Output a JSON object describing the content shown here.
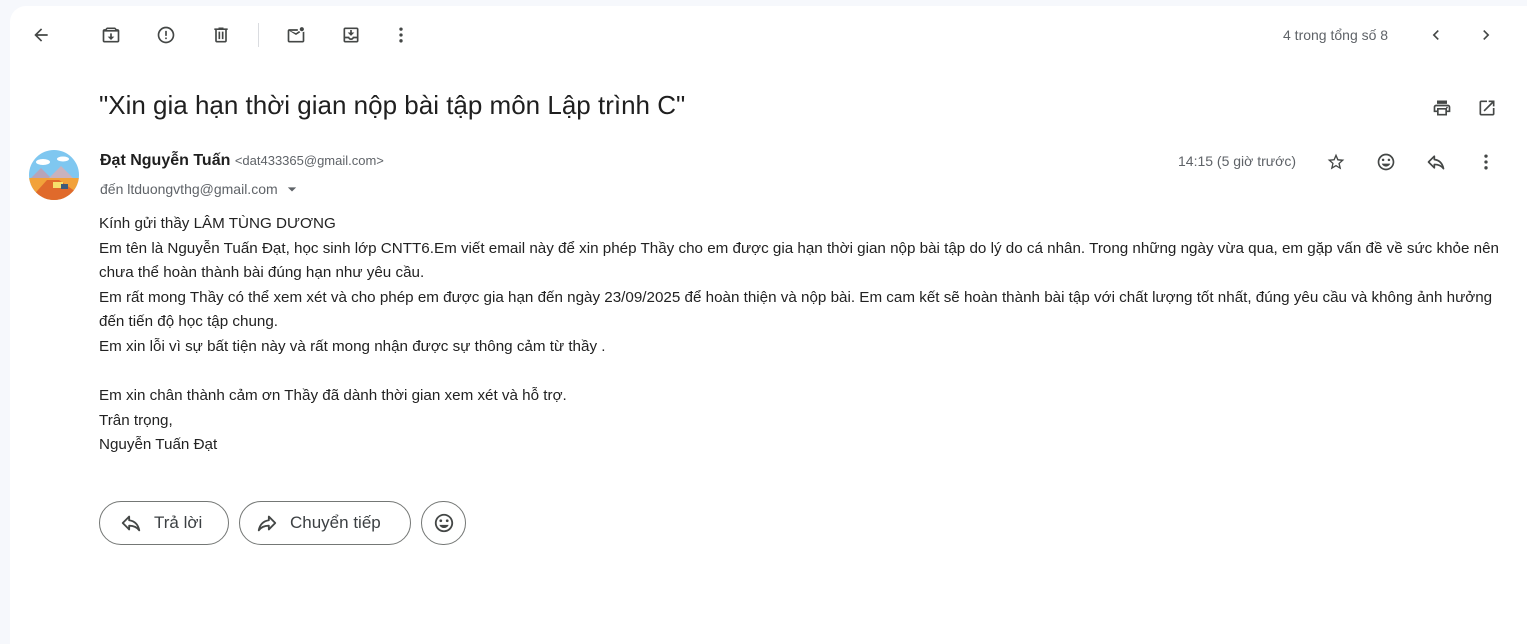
{
  "toolbar": {
    "icons": [
      "back-arrow-icon",
      "archive-icon",
      "report-spam-icon",
      "delete-icon",
      "mark-unread-icon",
      "move-to-icon",
      "more-vert-icon"
    ],
    "pagination": "4 trong tổng số 8"
  },
  "message": {
    "subject": "\"Xin gia hạn thời gian nộp bài tập môn Lập trình C\"",
    "sender_name": "Đạt Nguyễn Tuấn",
    "sender_email": "<dat433365@gmail.com>",
    "recipient": "đến ltduongvthg@gmail.com",
    "time": "14:15 (5 giờ trước)",
    "body": [
      "Kính gửi thầy LÂM TÙNG DƯƠNG",
      " Em tên là Nguyễn Tuấn Đạt, học sinh lớp CNTT6.Em viết email này để xin phép Thầy cho em được gia hạn thời gian nộp bài tập do lý do cá nhân. Trong những ngày vừa qua, em gặp vấn đề về sức khỏe nên chưa thể hoàn thành bài đúng hạn như yêu cầu.",
      "Em rất mong Thầy có thể xem xét và cho phép em được gia hạn đến ngày 23/09/2025 để hoàn thiện và nộp bài. Em cam kết sẽ hoàn thành bài tập với chất lượng tốt nhất, đúng yêu cầu và không ảnh hưởng đến tiến độ học tập chung.",
      "Em xin lỗi vì sự bất tiện này và rất mong nhận được sự thông cảm từ thầy .",
      "",
      "Em xin chân thành cảm ơn Thầy đã dành thời gian xem xét và hỗ trợ.",
      "Trân trọng,",
      "Nguyễn Tuấn Đạt"
    ]
  },
  "actions": {
    "reply_label": "Trả lời",
    "forward_label": "Chuyển tiếp"
  },
  "colors": {
    "background": "#f6f8fc",
    "panel": "#ffffff",
    "icon": "#444746",
    "muted_text": "#5f6368"
  }
}
